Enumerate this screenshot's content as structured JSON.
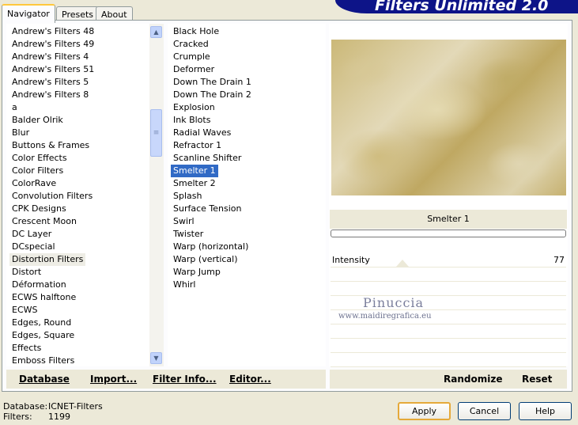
{
  "tabs": [
    {
      "label": "Navigator"
    },
    {
      "label": "Presets"
    },
    {
      "label": "About"
    }
  ],
  "app_title": "Filters Unlimited 2.0",
  "categories": [
    "Andrew's Filters 48",
    "Andrew's Filters 49",
    "Andrew's Filters 4",
    "Andrew's Filters 51",
    "Andrew's Filters 5",
    "Andrew's Filters 8",
    "a",
    "Balder Olrik",
    "Blur",
    "Buttons & Frames",
    "Color Effects",
    "Color Filters",
    "ColorRave",
    "Convolution Filters",
    "CPK Designs",
    "Crescent Moon",
    "DC Layer",
    "DCspecial",
    "Distortion Filters",
    "Distort",
    "Déformation",
    "ECWS halftone",
    "ECWS",
    "Edges, Round",
    "Edges, Square",
    "Effects",
    "Emboss Filters"
  ],
  "filters": [
    "Black Hole",
    "Cracked",
    "Crumple",
    "Deformer",
    "Down The Drain 1",
    "Down The Drain 2",
    "Explosion",
    "Ink Blots",
    "Radial Waves",
    "Refractor 1",
    "Scanline Shifter",
    "Smelter 1",
    "Smelter 2",
    "Splash",
    "Surface Tension",
    "Swirl",
    "Twister",
    "Warp (horizontal)",
    "Warp (vertical)",
    "Warp Jump",
    "Whirl"
  ],
  "selected_category_index": 18,
  "selected_filter_index": 11,
  "toolbar": {
    "database": "Database",
    "import": "Import...",
    "filter_info": "Filter Info...",
    "editor": "Editor...",
    "randomize": "Randomize",
    "reset": "Reset"
  },
  "filter_name": "Smelter 1",
  "parameter": {
    "label": "Intensity",
    "value": "77"
  },
  "watermark": {
    "name": "Pinuccia",
    "site": "www.maidiregrafica.eu"
  },
  "info": {
    "database_label": "Database:",
    "database_value": "ICNET-Filters",
    "filters_label": "Filters:",
    "filters_value": "1199"
  },
  "buttons": {
    "apply": "Apply",
    "cancel": "Cancel",
    "help": "Help"
  },
  "icons": {
    "scroll_up": "chevron-up-icon",
    "scroll_down": "chevron-down-icon",
    "thumb_grip": "grip-icon"
  },
  "colors": {
    "selection": "#316ac5",
    "banner": "#0d1488",
    "tab_accent": "#ffc83c",
    "default_button_ring": "#e5a93a"
  }
}
